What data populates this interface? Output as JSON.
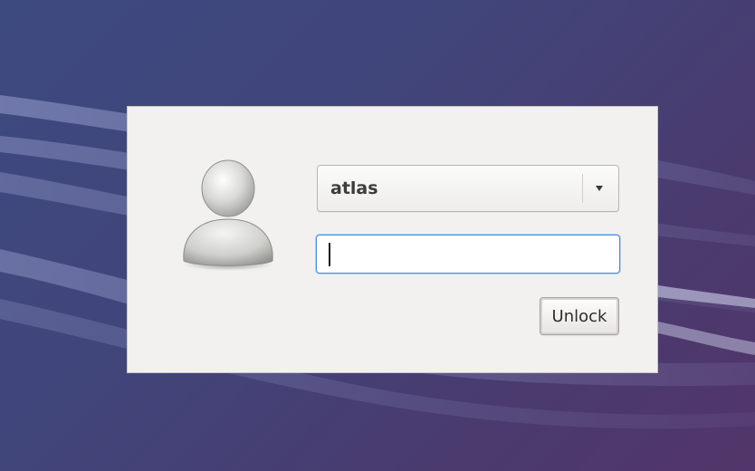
{
  "wallpaper": {
    "colors": [
      "#3d4a80",
      "#4a3a6e",
      "#52356a"
    ],
    "wave_color": "#8b8fc4"
  },
  "unlock_dialog": {
    "background_color": "#f2f1f0",
    "avatar": {
      "icon": "user-avatar-icon"
    },
    "user_selector": {
      "selected_value": "atlas",
      "dropdown_icon": "triangle-down-icon"
    },
    "password_field": {
      "value": "",
      "placeholder": "",
      "focus_color": "#4a90d9"
    },
    "unlock_button": {
      "label": "Unlock"
    }
  }
}
